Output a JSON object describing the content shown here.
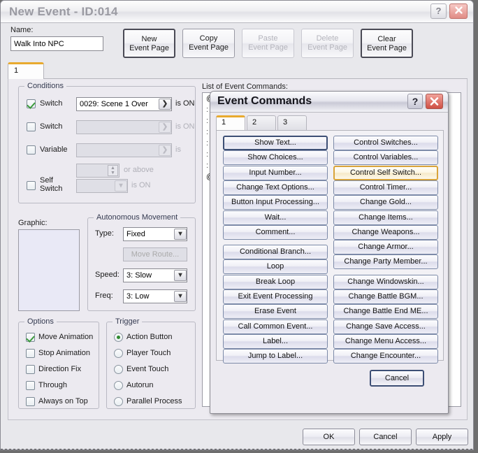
{
  "window": {
    "title": "New Event - ID:014",
    "help_icon": "?",
    "close_icon": "close-x"
  },
  "topbar": {
    "name_label": "Name:",
    "name_value": "Walk Into NPC",
    "name_placeholder": "",
    "page_buttons": [
      {
        "line1": "New",
        "line2": "Event Page",
        "state": "primary"
      },
      {
        "line1": "Copy",
        "line2": "Event Page",
        "state": "normal"
      },
      {
        "line1": "Paste",
        "line2": "Event Page",
        "state": "disabled"
      },
      {
        "line1": "Delete",
        "line2": "Event Page",
        "state": "disabled"
      },
      {
        "line1": "Clear",
        "line2": "Event Page",
        "state": "primary"
      }
    ]
  },
  "tabs": {
    "items": [
      {
        "label": "1",
        "active": true
      }
    ]
  },
  "conditions": {
    "legend": "Conditions",
    "rows": [
      {
        "checkbox_label": "Switch",
        "checked": true,
        "value": "0029: Scene 1 Over",
        "suffix": "is ON",
        "enabled": true
      },
      {
        "checkbox_label": "Switch",
        "checked": false,
        "value": "",
        "suffix": "is ON",
        "enabled": false
      },
      {
        "checkbox_label": "Variable",
        "checked": false,
        "value": "",
        "suffix": "is",
        "enabled": false
      },
      {
        "checkbox_label": "",
        "checked": null,
        "value": "",
        "suffix": "or above",
        "enabled": false
      },
      {
        "checkbox_label": "Self Switch",
        "checked": false,
        "value": "",
        "suffix": "is ON",
        "enabled": false
      }
    ],
    "arrow_glyph": "❯"
  },
  "graphic": {
    "label": "Graphic:"
  },
  "autonomous_movement": {
    "legend": "Autonomous Movement",
    "type_label": "Type:",
    "type_value": "Fixed",
    "move_route_label": "Move Route...",
    "speed_label": "Speed:",
    "speed_value": "3: Slow",
    "freq_label": "Freq:",
    "freq_value": "3: Low"
  },
  "options": {
    "legend": "Options",
    "items": [
      {
        "label": "Move Animation",
        "checked": true
      },
      {
        "label": "Stop Animation",
        "checked": false
      },
      {
        "label": "Direction Fix",
        "checked": false
      },
      {
        "label": "Through",
        "checked": false
      },
      {
        "label": "Always on Top",
        "checked": false
      }
    ]
  },
  "trigger": {
    "legend": "Trigger",
    "items": [
      {
        "label": "Action Button",
        "selected": true
      },
      {
        "label": "Player Touch",
        "selected": false
      },
      {
        "label": "Event Touch",
        "selected": false
      },
      {
        "label": "Autorun",
        "selected": false
      },
      {
        "label": "Parallel Process",
        "selected": false
      }
    ]
  },
  "command_list": {
    "label": "List of Event Commands:",
    "rows": [
      {
        "text": "@>",
        "type": "entry"
      },
      {
        "text": ":",
        "type": "dots"
      },
      {
        "text": ":",
        "type": "dots"
      },
      {
        "text": ":",
        "type": "dots"
      },
      {
        "text": ":",
        "type": "dots"
      },
      {
        "text": ":",
        "type": "dots"
      },
      {
        "text": ":",
        "type": "dots"
      },
      {
        "text": "@>",
        "type": "entry"
      }
    ]
  },
  "event_commands_dialog": {
    "title": "Event Commands",
    "help_icon": "?",
    "close_icon": "close-x",
    "tabs": [
      {
        "label": "1",
        "active": true
      },
      {
        "label": "2",
        "active": false
      },
      {
        "label": "3",
        "active": false
      }
    ],
    "left_column": [
      {
        "label": "Show Text...",
        "state": "focused"
      },
      {
        "label": "Show Choices...",
        "state": "normal"
      },
      {
        "label": "Input Number...",
        "state": "normal"
      },
      {
        "label": "Change Text Options...",
        "state": "normal"
      },
      {
        "label": "Button Input Processing...",
        "state": "normal"
      },
      {
        "label": "Wait...",
        "state": "normal"
      },
      {
        "label": "Comment...",
        "state": "normal"
      },
      {
        "label": "Conditional Branch...",
        "state": "normal",
        "gap": true
      },
      {
        "label": "Loop",
        "state": "normal"
      },
      {
        "label": "Break Loop",
        "state": "normal"
      },
      {
        "label": "Exit Event Processing",
        "state": "normal"
      },
      {
        "label": "Erase Event",
        "state": "normal"
      },
      {
        "label": "Call Common Event...",
        "state": "normal"
      },
      {
        "label": "Label...",
        "state": "normal"
      },
      {
        "label": "Jump to Label...",
        "state": "normal"
      }
    ],
    "right_column": [
      {
        "label": "Control Switches...",
        "state": "normal"
      },
      {
        "label": "Control Variables...",
        "state": "normal"
      },
      {
        "label": "Control Self Switch...",
        "state": "hovered"
      },
      {
        "label": "Control Timer...",
        "state": "normal"
      },
      {
        "label": "Change Gold...",
        "state": "normal"
      },
      {
        "label": "Change Items...",
        "state": "normal"
      },
      {
        "label": "Change Weapons...",
        "state": "normal"
      },
      {
        "label": "Change Armor...",
        "state": "normal"
      },
      {
        "label": "Change Party Member...",
        "state": "normal"
      },
      {
        "label": "Change Windowskin...",
        "state": "normal",
        "gap": true
      },
      {
        "label": "Change Battle BGM...",
        "state": "normal"
      },
      {
        "label": "Change Battle End ME...",
        "state": "normal"
      },
      {
        "label": "Change Save Access...",
        "state": "normal"
      },
      {
        "label": "Change Menu Access...",
        "state": "normal"
      },
      {
        "label": "Change Encounter...",
        "state": "normal"
      }
    ],
    "cancel_label": "Cancel"
  },
  "bottom_buttons": [
    {
      "label": "OK"
    },
    {
      "label": "Cancel"
    },
    {
      "label": "Apply"
    }
  ],
  "colors": {
    "accent_tab": "#e8aa2e",
    "hover_border": "#d9a43a",
    "focus_border": "#3d4f75",
    "check_green": "#3c9b3c",
    "close_red": "#cf4f44",
    "title_text": "#9a9aa2",
    "legend_text": "#343a50"
  }
}
